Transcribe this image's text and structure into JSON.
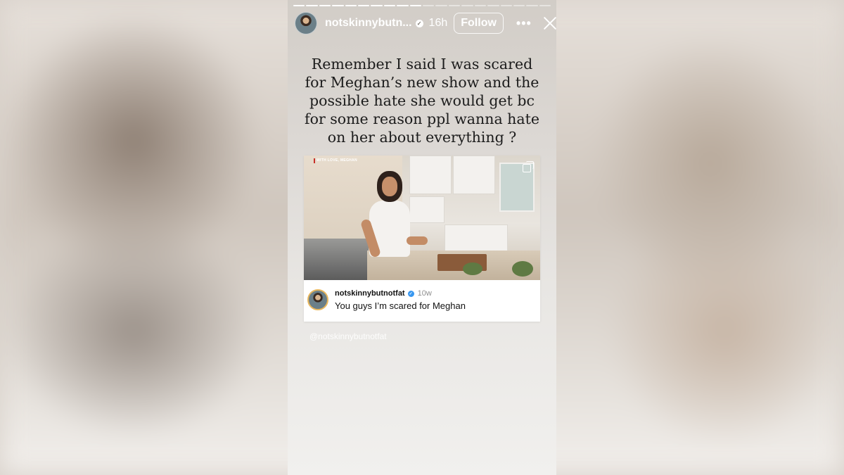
{
  "story": {
    "progress": {
      "completed": 10,
      "total": 20
    },
    "header": {
      "username": "notskinnybutn...",
      "verified_mark": "✓",
      "time": "16h",
      "follow_label": "Follow",
      "more_icon": "•••"
    },
    "caption": "Remember I said I was scared for Meghan’s new show and the possible hate she would get bc for some reason ppl wanna hate on her about everything ?",
    "shared_post": {
      "media_label": "WITH LOVE, MEGHAN",
      "username": "notskinnybutnotfat",
      "verified_mark": "✓",
      "time": "10w",
      "text": "You guys I’m scared for Meghan"
    },
    "mention": "@notskinnybutnotfat"
  },
  "colors": {
    "text_on_story": "#ffffff",
    "caption_text": "#1c1c1c",
    "verified_blue": "#3897f0",
    "avatar_ring": "#e9b75d"
  }
}
